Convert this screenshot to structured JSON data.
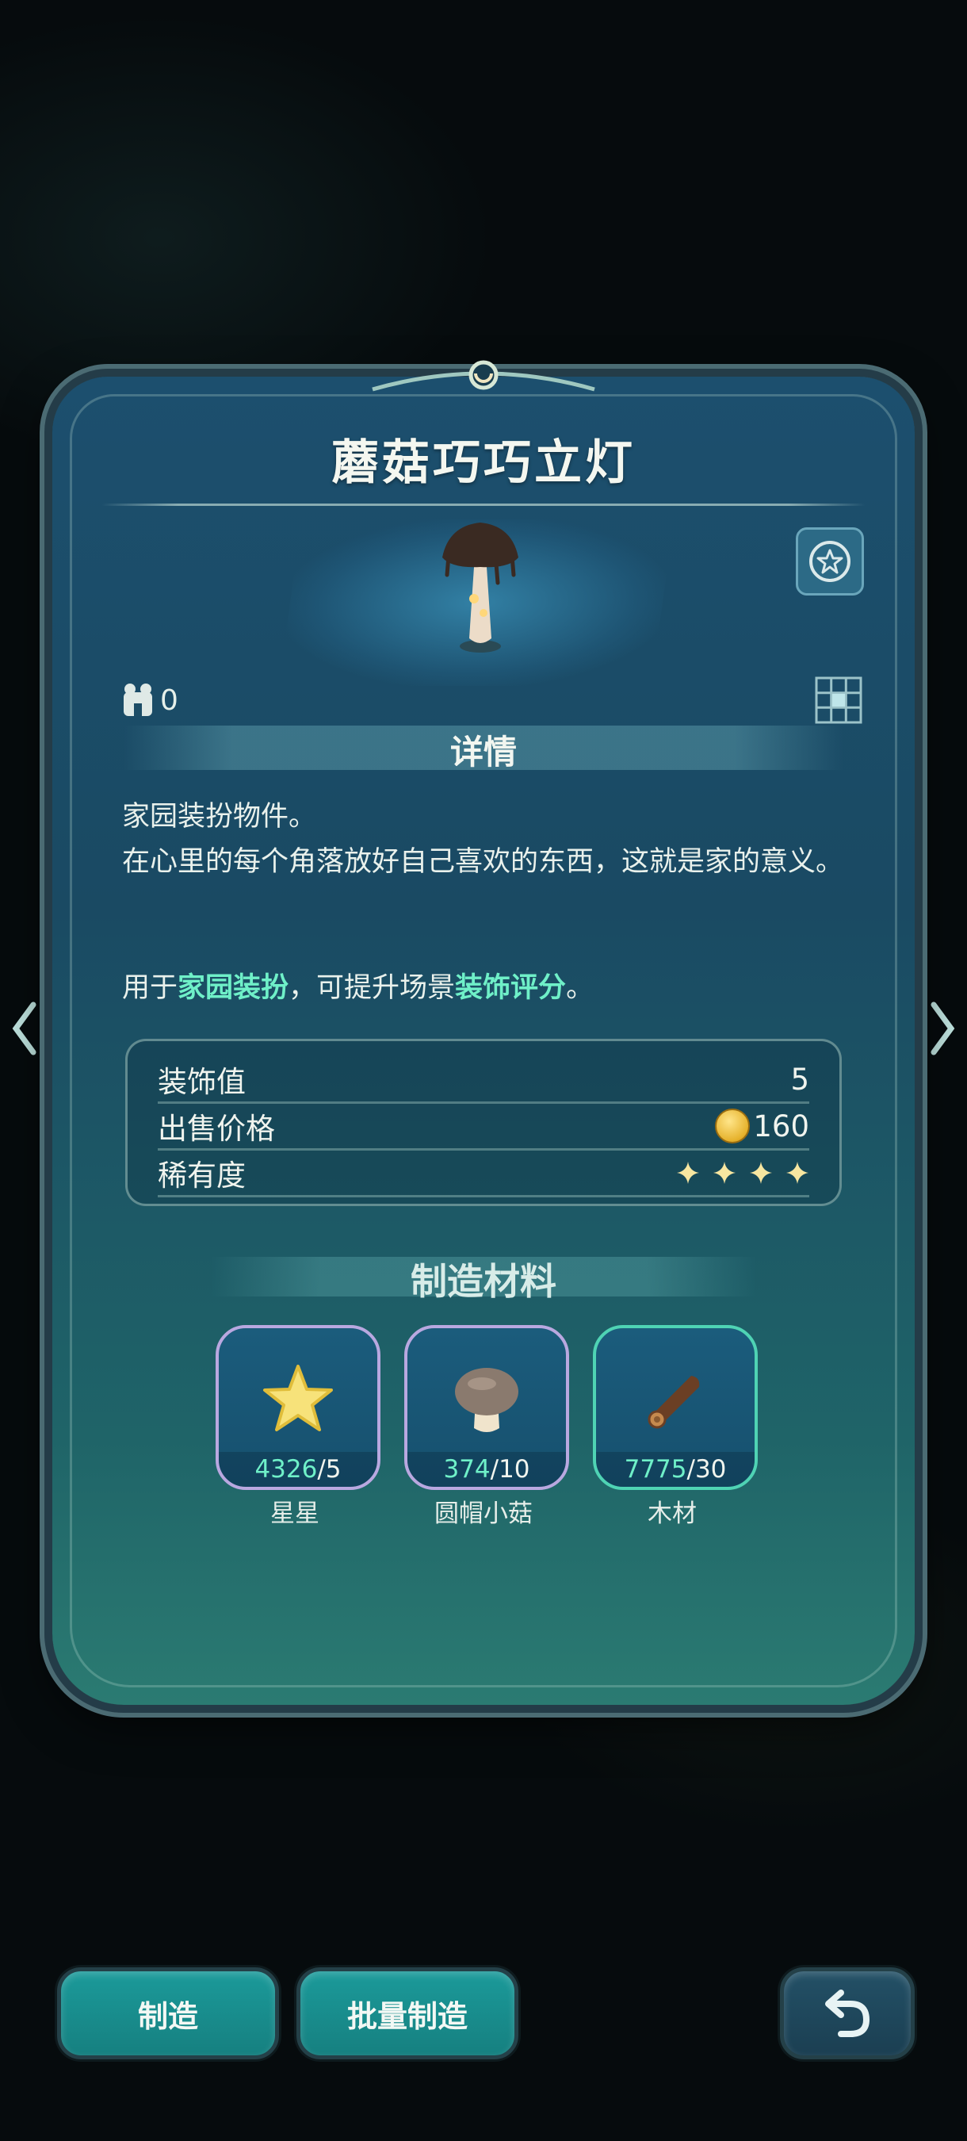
{
  "item": {
    "title": "蘑菇巧巧立灯",
    "owned_count": "0",
    "section_title": "详情",
    "description_lines": [
      "家园装扮物件。",
      "在心里的每个角落放好自己喜欢的东西，这就是家的意义。"
    ],
    "usage": {
      "prefix": "用于",
      "highlight1": "家园装扮",
      "middle": "，可提升场景",
      "highlight2": "装饰评分",
      "suffix": "。"
    },
    "highlight_color": "#6ff0c8"
  },
  "stats": {
    "decor_label": "装饰值",
    "decor_value": "5",
    "price_label": "出售价格",
    "price_value": "160",
    "rarity_label": "稀有度",
    "rarity_stars": 4
  },
  "materials": {
    "title": "制造材料",
    "items": [
      {
        "name": "星星",
        "have": "4326",
        "need": "/5",
        "icon": "star-icon"
      },
      {
        "name": "圆帽小菇",
        "have": "374",
        "need": "/10",
        "icon": "mushroom-icon"
      },
      {
        "name": "木材",
        "have": "7775",
        "need": "/30",
        "icon": "log-icon"
      }
    ]
  },
  "buttons": {
    "craft": "制造",
    "batch_craft": "批量制造",
    "back_icon": "return-arrow-icon"
  }
}
